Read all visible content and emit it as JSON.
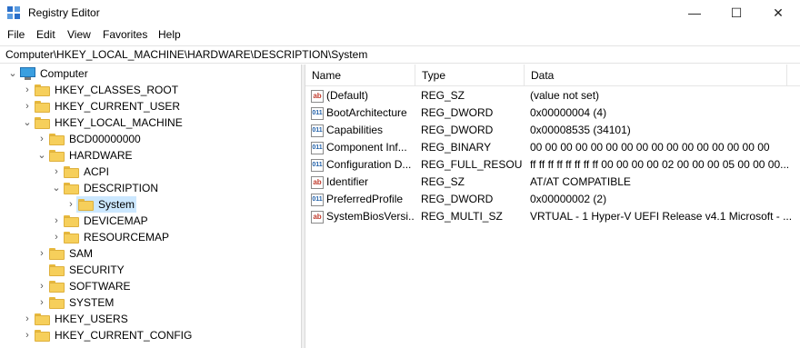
{
  "window": {
    "title": "Registry Editor",
    "minimize_glyph": "—",
    "maximize_glyph": "☐",
    "close_glyph": "✕"
  },
  "menu": [
    "File",
    "Edit",
    "View",
    "Favorites",
    "Help"
  ],
  "address": "Computer\\HKEY_LOCAL_MACHINE\\HARDWARE\\DESCRIPTION\\System",
  "tree": [
    {
      "label": "Computer",
      "icon": "computer-icon",
      "state": "expanded"
    },
    {
      "label": "HKEY_CLASSES_ROOT",
      "icon": "folder-icon",
      "state": "collapsed"
    },
    {
      "label": "HKEY_CURRENT_USER",
      "icon": "folder-icon",
      "state": "collapsed"
    },
    {
      "label": "HKEY_LOCAL_MACHINE",
      "icon": "folder-icon",
      "state": "expanded"
    },
    {
      "label": "BCD00000000",
      "icon": "folder-icon",
      "state": "collapsed"
    },
    {
      "label": "HARDWARE",
      "icon": "folder-icon",
      "state": "expanded"
    },
    {
      "label": "ACPI",
      "icon": "folder-icon",
      "state": "collapsed"
    },
    {
      "label": "DESCRIPTION",
      "icon": "folder-icon",
      "state": "expanded"
    },
    {
      "label": "System",
      "icon": "folder-icon",
      "state": "collapsed",
      "selected": true
    },
    {
      "label": "DEVICEMAP",
      "icon": "folder-icon",
      "state": "collapsed"
    },
    {
      "label": "RESOURCEMAP",
      "icon": "folder-icon",
      "state": "collapsed"
    },
    {
      "label": "SAM",
      "icon": "folder-icon",
      "state": "collapsed"
    },
    {
      "label": "SECURITY",
      "icon": "folder-icon",
      "state": "none"
    },
    {
      "label": "SOFTWARE",
      "icon": "folder-icon",
      "state": "collapsed"
    },
    {
      "label": "SYSTEM",
      "icon": "folder-icon",
      "state": "collapsed"
    },
    {
      "label": "HKEY_USERS",
      "icon": "folder-icon",
      "state": "collapsed"
    },
    {
      "label": "HKEY_CURRENT_CONFIG",
      "icon": "folder-icon",
      "state": "collapsed"
    }
  ],
  "columns": {
    "name": "Name",
    "type": "Type",
    "data": "Data"
  },
  "values": [
    {
      "icon": "string-value-icon",
      "name": "(Default)",
      "type": "REG_SZ",
      "data": "(value not set)"
    },
    {
      "icon": "binary-value-icon",
      "name": "BootArchitecture",
      "type": "REG_DWORD",
      "data": "0x00000004 (4)"
    },
    {
      "icon": "binary-value-icon",
      "name": "Capabilities",
      "type": "REG_DWORD",
      "data": "0x00008535 (34101)"
    },
    {
      "icon": "binary-value-icon",
      "name": "Component Inf...",
      "type": "REG_BINARY",
      "data": "00 00 00 00 00 00 00 00 00 00 00 00 00 00 00 00"
    },
    {
      "icon": "binary-value-icon",
      "name": "Configuration D...",
      "type": "REG_FULL_RESOU...",
      "data": "ff ff ff ff ff ff ff ff 00 00 00 00 02 00 00 00 05 00 00 00..."
    },
    {
      "icon": "string-value-icon",
      "name": "Identifier",
      "type": "REG_SZ",
      "data": "AT/AT COMPATIBLE"
    },
    {
      "icon": "binary-value-icon",
      "name": "PreferredProfile",
      "type": "REG_DWORD",
      "data": "0x00000002 (2)"
    },
    {
      "icon": "string-value-icon",
      "name": "SystemBiosVersi...",
      "type": "REG_MULTI_SZ",
      "data": "VRTUAL - 1 Hyper-V UEFI Release v4.1 Microsoft - ..."
    }
  ],
  "colors": {
    "selection": "#cce8ff",
    "folder": "#f6cf5b"
  }
}
